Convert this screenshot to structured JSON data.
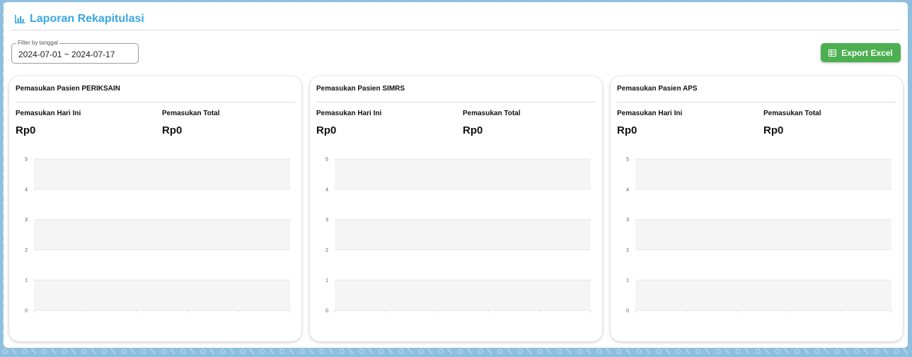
{
  "header": {
    "title": "Laporan Rekapitulasi",
    "icon": "bar-chart-icon"
  },
  "filter": {
    "label": "Filter by tanggal",
    "value": "2024-07-01 ~ 2024-07-17"
  },
  "toolbar": {
    "export_label": "Export Excel",
    "export_icon": "spreadsheet-icon"
  },
  "colors": {
    "accent": "#3aa7e6",
    "export": "#4caf50",
    "background": "#8fbfdf",
    "band": "#f5f5f5"
  },
  "cards": [
    {
      "title": "Pemasukan Pasien PERIKSAIN",
      "today_label": "Pemasukan Hari Ini",
      "today_value": "Rp0",
      "total_label": "Pemasukan Total",
      "total_value": "Rp0"
    },
    {
      "title": "Pemasukan Pasien SIMRS",
      "today_label": "Pemasukan Hari Ini",
      "today_value": "Rp0",
      "total_label": "Pemasukan Total",
      "total_value": "Rp0"
    },
    {
      "title": "Pemasukan Pasien APS",
      "today_label": "Pemasukan Hari Ini",
      "today_value": "Rp0",
      "total_label": "Pemasukan Total",
      "total_value": "Rp0"
    }
  ],
  "chart_data": [
    {
      "type": "area",
      "x": [],
      "series": [],
      "ylim": [
        0,
        5
      ],
      "yticks": [
        "0",
        "1",
        "2",
        "3",
        "4",
        "5"
      ],
      "grid": true,
      "legend": "none"
    },
    {
      "type": "area",
      "x": [],
      "series": [],
      "ylim": [
        0,
        5
      ],
      "yticks": [
        "0",
        "1",
        "2",
        "3",
        "4",
        "5"
      ],
      "grid": true,
      "legend": "none"
    },
    {
      "type": "area",
      "x": [],
      "series": [],
      "ylim": [
        0,
        5
      ],
      "yticks": [
        "0",
        "1",
        "2",
        "3",
        "4",
        "5"
      ],
      "grid": true,
      "legend": "none"
    }
  ]
}
